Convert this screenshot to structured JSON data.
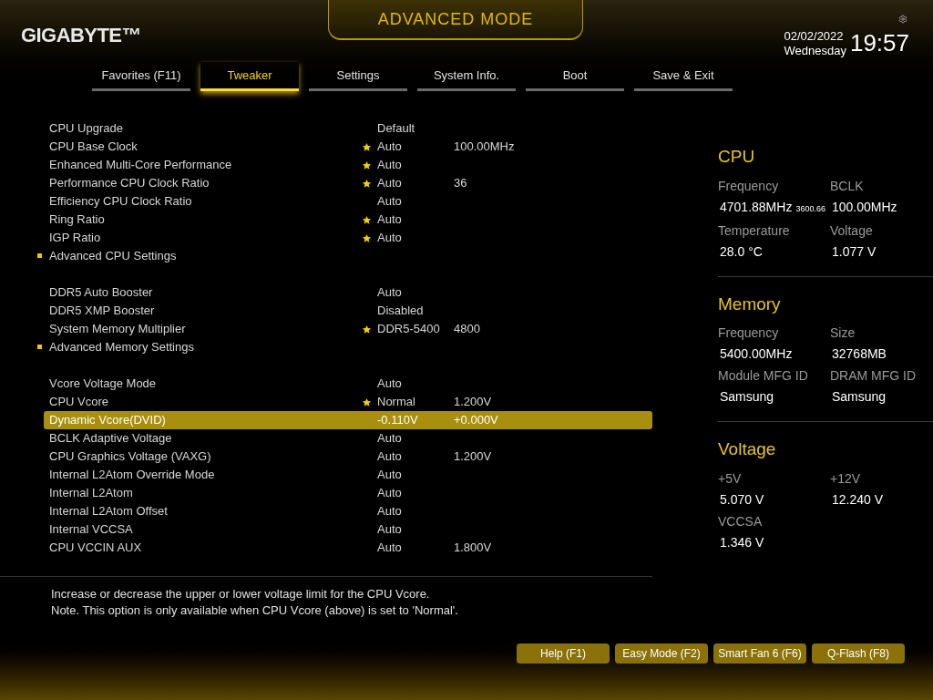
{
  "header": {
    "logo": "GIGABYTE™",
    "mode": "ADVANCED MODE",
    "date": "02/02/2022",
    "weekday": "Wednesday",
    "time": "19:57"
  },
  "tabs": [
    {
      "label": "Favorites (F11)",
      "selected": false
    },
    {
      "label": "Tweaker",
      "selected": true
    },
    {
      "label": "Settings",
      "selected": false
    },
    {
      "label": "System Info.",
      "selected": false
    },
    {
      "label": "Boot",
      "selected": false
    },
    {
      "label": "Save & Exit",
      "selected": false
    }
  ],
  "settings": [
    {
      "rows": [
        {
          "kind": "setting",
          "label": "CPU Upgrade",
          "value": "Default",
          "starred": false,
          "selected": false
        },
        {
          "kind": "setting",
          "label": "CPU Base Clock",
          "value": "Auto",
          "value2": "100.00MHz",
          "starred": true,
          "selected": false
        },
        {
          "kind": "setting",
          "label": "Enhanced Multi-Core Performance",
          "value": "Auto",
          "starred": true,
          "selected": false
        },
        {
          "kind": "setting",
          "label": "Performance CPU Clock Ratio",
          "value": "Auto",
          "value2": "36",
          "starred": true,
          "selected": false
        },
        {
          "kind": "setting",
          "label": "Efficiency CPU Clock Ratio",
          "value": "Auto",
          "starred": false,
          "selected": false
        },
        {
          "kind": "setting",
          "label": "Ring Ratio",
          "value": "Auto",
          "starred": true,
          "selected": false
        },
        {
          "kind": "setting",
          "label": "IGP Ratio",
          "value": "Auto",
          "starred": true,
          "selected": false
        },
        {
          "kind": "submenu",
          "label": "Advanced CPU Settings",
          "selected": false
        }
      ]
    },
    {
      "rows": [
        {
          "kind": "setting",
          "label": "DDR5 Auto Booster",
          "value": "Auto",
          "starred": false,
          "selected": false
        },
        {
          "kind": "setting",
          "label": "DDR5 XMP Booster",
          "value": "Disabled",
          "starred": false,
          "selected": false
        },
        {
          "kind": "setting",
          "label": "System Memory Multiplier",
          "value": "DDR5-5400",
          "value2": "4800",
          "starred": true,
          "selected": false
        },
        {
          "kind": "submenu",
          "label": "Advanced Memory Settings",
          "selected": false
        }
      ]
    },
    {
      "rows": [
        {
          "kind": "setting",
          "label": "Vcore Voltage Mode",
          "value": "Auto",
          "starred": false,
          "selected": false
        },
        {
          "kind": "setting",
          "label": "CPU Vcore",
          "value": "Normal",
          "value2": "1.200V",
          "starred": true,
          "selected": false
        },
        {
          "kind": "setting",
          "label": "Dynamic Vcore(DVID)",
          "value": "-0.110V",
          "value2": "+0.000V",
          "starred": false,
          "selected": true
        },
        {
          "kind": "setting",
          "label": "BCLK Adaptive Voltage",
          "value": "Auto",
          "starred": false,
          "selected": false
        },
        {
          "kind": "setting",
          "label": "CPU Graphics Voltage (VAXG)",
          "value": "Auto",
          "value2": "1.200V",
          "starred": false,
          "selected": false
        },
        {
          "kind": "setting",
          "label": "Internal L2Atom Override Mode",
          "value": "Auto",
          "starred": false,
          "selected": false
        },
        {
          "kind": "setting",
          "label": "Internal L2Atom",
          "value": "Auto",
          "starred": false,
          "selected": false
        },
        {
          "kind": "setting",
          "label": "Internal L2Atom Offset",
          "value": "Auto",
          "starred": false,
          "selected": false
        },
        {
          "kind": "setting",
          "label": "Internal VCCSA",
          "value": "Auto",
          "starred": false,
          "selected": false
        },
        {
          "kind": "setting",
          "label": "CPU VCCIN AUX",
          "value": "Auto",
          "value2": "1.800V",
          "starred": false,
          "selected": false
        }
      ]
    }
  ],
  "help": [
    "Increase or decrease the upper or lower voltage limit for the CPU Vcore.",
    "Note. This option is only available when CPU Vcore (above) is set to 'Normal'."
  ],
  "info": [
    {
      "title": "CPU",
      "fields": [
        {
          "label": "Frequency",
          "value": "4701.88MHz",
          "note": "3600.66"
        },
        {
          "label": "BCLK",
          "value": "100.00MHz"
        },
        {
          "label": "Temperature",
          "value": "28.0 °C"
        },
        {
          "label": "Voltage",
          "value": "1.077 V"
        }
      ]
    },
    {
      "title": "Memory",
      "fields": [
        {
          "label": "Frequency",
          "value": "5400.00MHz"
        },
        {
          "label": "Size",
          "value": "32768MB"
        },
        {
          "label": "Module MFG ID",
          "value": "Samsung"
        },
        {
          "label": "DRAM MFG ID",
          "value": "Samsung"
        }
      ]
    },
    {
      "title": "Voltage",
      "fields": [
        {
          "label": "+5V",
          "value": "5.070 V"
        },
        {
          "label": "+12V",
          "value": "12.240 V"
        },
        {
          "label": "VCCSA",
          "value": "1.346 V"
        }
      ]
    }
  ],
  "buttons": [
    "Help (F1)",
    "Easy Mode (F2)",
    "Smart Fan 6 (F6)",
    "Q-Flash (F8)"
  ]
}
